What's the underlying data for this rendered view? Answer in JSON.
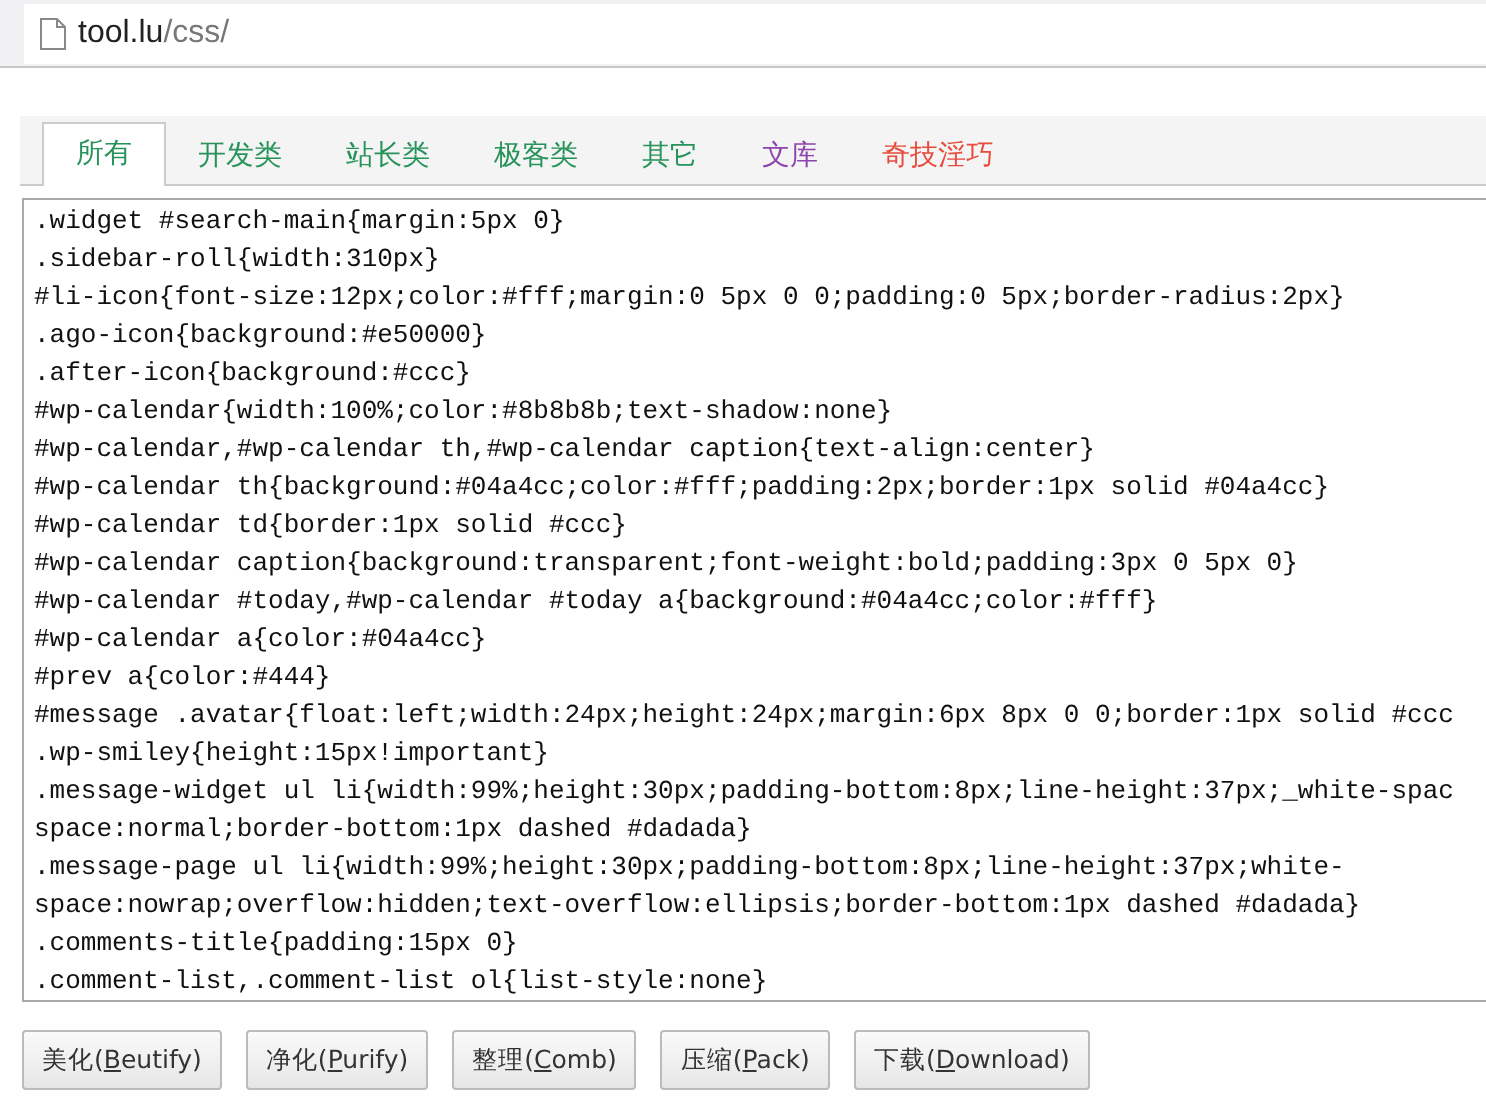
{
  "address_bar": {
    "host": "tool.lu",
    "path": "/css/"
  },
  "tabs": [
    {
      "label": "所有",
      "selected": true,
      "color": "#27935a"
    },
    {
      "label": "开发类",
      "selected": false,
      "color": "#27935a"
    },
    {
      "label": "站长类",
      "selected": false,
      "color": "#27935a"
    },
    {
      "label": "极客类",
      "selected": false,
      "color": "#27935a"
    },
    {
      "label": "其它",
      "selected": false,
      "color": "#27935a"
    },
    {
      "label": "文库",
      "selected": false,
      "color": "#8e44ad"
    },
    {
      "label": "奇技淫巧",
      "selected": false,
      "color": "#e74c3c"
    }
  ],
  "editor": {
    "lines": [
      ".widget #search-main{margin:5px 0}",
      ".sidebar-roll{width:310px}",
      "#li-icon{font-size:12px;color:#fff;margin:0 5px 0 0;padding:0 5px;border-radius:2px}",
      ".ago-icon{background:#e50000}",
      ".after-icon{background:#ccc}",
      "#wp-calendar{width:100%;color:#8b8b8b;text-shadow:none}",
      "#wp-calendar,#wp-calendar th,#wp-calendar caption{text-align:center}",
      "#wp-calendar th{background:#04a4cc;color:#fff;padding:2px;border:1px solid #04a4cc}",
      "#wp-calendar td{border:1px solid #ccc}",
      "#wp-calendar caption{background:transparent;font-weight:bold;padding:3px 0 5px 0}",
      "#wp-calendar #today,#wp-calendar #today a{background:#04a4cc;color:#fff}",
      "#wp-calendar a{color:#04a4cc}",
      "#prev a{color:#444}",
      "#message .avatar{float:left;width:24px;height:24px;margin:6px 8px 0 0;border:1px solid #ccc",
      ".wp-smiley{height:15px!important}",
      ".message-widget ul li{width:99%;height:30px;padding-bottom:8px;line-height:37px;_white-spac",
      "space:normal;border-bottom:1px dashed #dadada}",
      ".message-page ul li{width:99%;height:30px;padding-bottom:8px;line-height:37px;white-",
      "space:nowrap;overflow:hidden;text-overflow:ellipsis;border-bottom:1px dashed #dadada}",
      ".comments-title{padding:15px 0}",
      ".comment-list,.comment-list ol{list-style:none}"
    ]
  },
  "buttons": [
    {
      "before": "美化(",
      "key": "B",
      "after": "eutify)"
    },
    {
      "before": "净化(",
      "key": "P",
      "after": "urify)"
    },
    {
      "before": "整理(",
      "key": "C",
      "after": "omb)"
    },
    {
      "before": "压缩(",
      "key": "P",
      "after": "ack)"
    },
    {
      "before": "下载(",
      "key": "D",
      "after": "ownload)"
    }
  ]
}
